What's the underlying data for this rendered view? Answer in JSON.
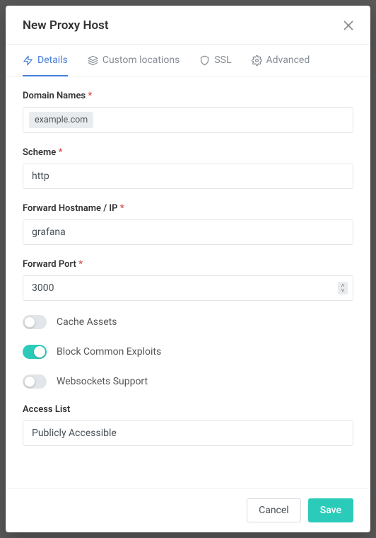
{
  "header": {
    "title": "New Proxy Host"
  },
  "tabs": {
    "details": "Details",
    "custom_locations": "Custom locations",
    "ssl": "SSL",
    "advanced": "Advanced"
  },
  "labels": {
    "domain_names": "Domain Names",
    "scheme": "Scheme",
    "forward_host": "Forward Hostname / IP",
    "forward_port": "Forward Port",
    "cache_assets": "Cache Assets",
    "block_exploits": "Block Common Exploits",
    "websockets": "Websockets Support",
    "access_list": "Access List"
  },
  "values": {
    "domain_tag": "example.com",
    "scheme": "http",
    "forward_host": "grafana",
    "forward_port": "3000",
    "access_list": "Publicly Accessible"
  },
  "toggles": {
    "cache_assets": false,
    "block_exploits": true,
    "websockets": false
  },
  "buttons": {
    "cancel": "Cancel",
    "save": "Save"
  },
  "colors": {
    "accent_blue": "#467fdb",
    "accent_teal": "#2bcbba",
    "required_star": "#d9534f"
  }
}
